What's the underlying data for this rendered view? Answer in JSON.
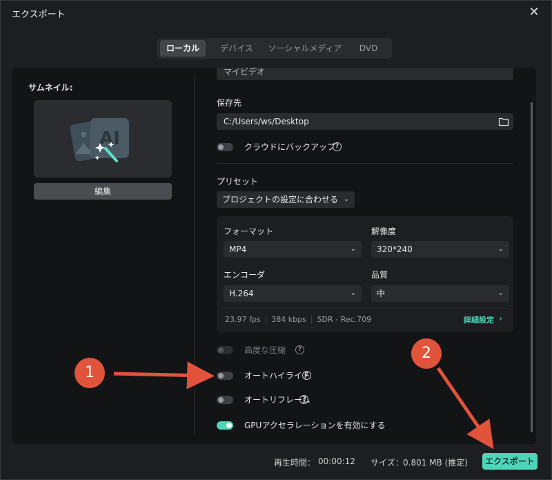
{
  "window": {
    "title": "エクスポート"
  },
  "tabs": [
    {
      "label": "ローカル",
      "active": true
    },
    {
      "label": "デバイス",
      "active": false
    },
    {
      "label": "ソーシャルメディア",
      "active": false
    },
    {
      "label": "DVD",
      "active": false
    }
  ],
  "thumbnail": {
    "label": "サムネイル:",
    "edit_label": "編集"
  },
  "name": {
    "value": "マイビデオ"
  },
  "save": {
    "label": "保存先",
    "path": "C:/Users/ws/Desktop"
  },
  "cloud_backup": {
    "label": "クラウドにバックアップ",
    "on": false
  },
  "preset": {
    "label": "プリセット",
    "value": "プロジェクトの設定に合わせる"
  },
  "settings": {
    "format_label": "フォーマット",
    "format_value": "MP4",
    "resolution_label": "解像度",
    "resolution_value": "320*240",
    "encoder_label": "エンコーダ",
    "encoder_value": "H.264",
    "quality_label": "品質",
    "quality_value": "中",
    "fps": "23.97 fps",
    "bitrate": "384 kbps",
    "color": "SDR - Rec.709",
    "details_label": "詳細設定"
  },
  "options": {
    "advanced_compression": {
      "label": "高度な圧縮",
      "on": false,
      "enabled": false
    },
    "auto_highlight": {
      "label": "オートハイライト",
      "on": false
    },
    "auto_reframe": {
      "label": "オートリフレーム",
      "on": false
    },
    "gpu": {
      "label": "GPUアクセラレーションを有効にする",
      "on": true
    }
  },
  "footer": {
    "duration_label": "再生時間：",
    "duration_value": "00:00:12",
    "size_label": "サイズ：",
    "size_value": "0.801 MB (推定)",
    "export_label": "エクスポート"
  },
  "annotations": {
    "marker1": "1",
    "marker2": "2"
  },
  "colors": {
    "accent": "#4fd5b8",
    "annotation": "#e2533c"
  }
}
